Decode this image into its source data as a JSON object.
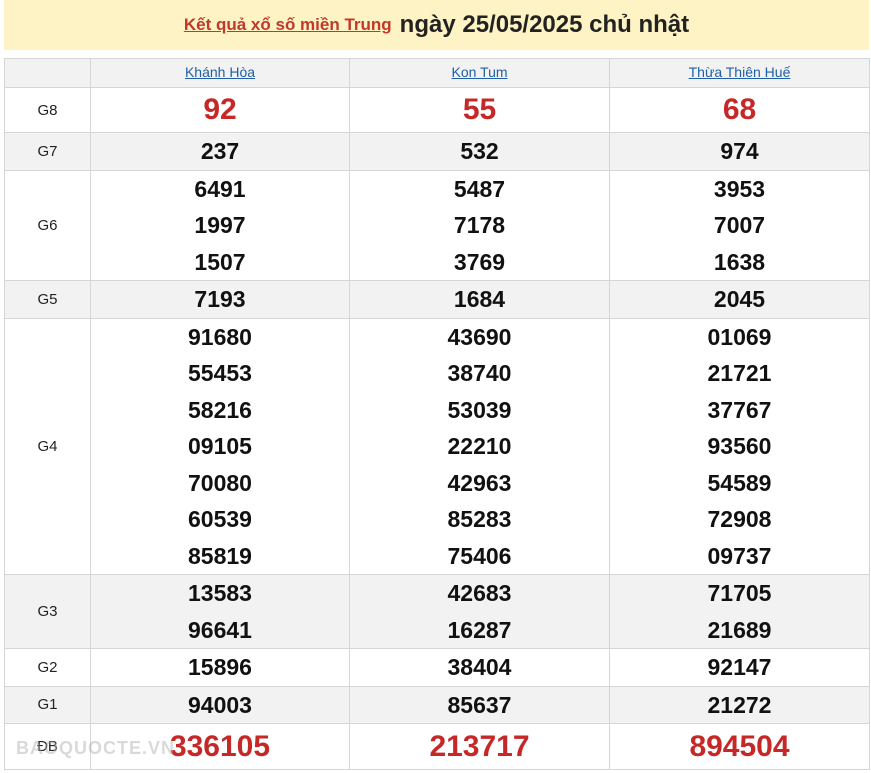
{
  "header": {
    "link_text": "Kết quả xổ số miền Trung",
    "title_rest": "ngày 25/05/2025 chủ nhật"
  },
  "provinces": [
    "Khánh Hòa",
    "Kon Tum",
    "Thừa Thiên Huế"
  ],
  "prizes": [
    {
      "label": "G8",
      "values": [
        [
          "92"
        ],
        [
          "55"
        ],
        [
          "68"
        ]
      ]
    },
    {
      "label": "G7",
      "values": [
        [
          "237"
        ],
        [
          "532"
        ],
        [
          "974"
        ]
      ]
    },
    {
      "label": "G6",
      "values": [
        [
          "6491",
          "1997",
          "1507"
        ],
        [
          "5487",
          "7178",
          "3769"
        ],
        [
          "3953",
          "7007",
          "1638"
        ]
      ]
    },
    {
      "label": "G5",
      "values": [
        [
          "7193"
        ],
        [
          "1684"
        ],
        [
          "2045"
        ]
      ]
    },
    {
      "label": "G4",
      "values": [
        [
          "91680",
          "55453",
          "58216",
          "09105",
          "70080",
          "60539",
          "85819"
        ],
        [
          "43690",
          "38740",
          "53039",
          "22210",
          "42963",
          "85283",
          "75406"
        ],
        [
          "01069",
          "21721",
          "37767",
          "93560",
          "54589",
          "72908",
          "09737"
        ]
      ]
    },
    {
      "label": "G3",
      "values": [
        [
          "13583",
          "96641"
        ],
        [
          "42683",
          "16287"
        ],
        [
          "71705",
          "21689"
        ]
      ]
    },
    {
      "label": "G2",
      "values": [
        [
          "15896"
        ],
        [
          "38404"
        ],
        [
          "92147"
        ]
      ]
    },
    {
      "label": "G1",
      "values": [
        [
          "94003"
        ],
        [
          "85637"
        ],
        [
          "21272"
        ]
      ]
    },
    {
      "label": "ĐB",
      "values": [
        [
          "336105"
        ],
        [
          "213717"
        ],
        [
          "894504"
        ]
      ]
    }
  ],
  "watermark": "BAOQUOCTE.VN",
  "colors": {
    "header_bg": "#fdf3c4",
    "link_red": "#c0392b",
    "number_red": "#c62828",
    "province_blue": "#1f5fa8",
    "row_shade": "#f2f2f2"
  }
}
